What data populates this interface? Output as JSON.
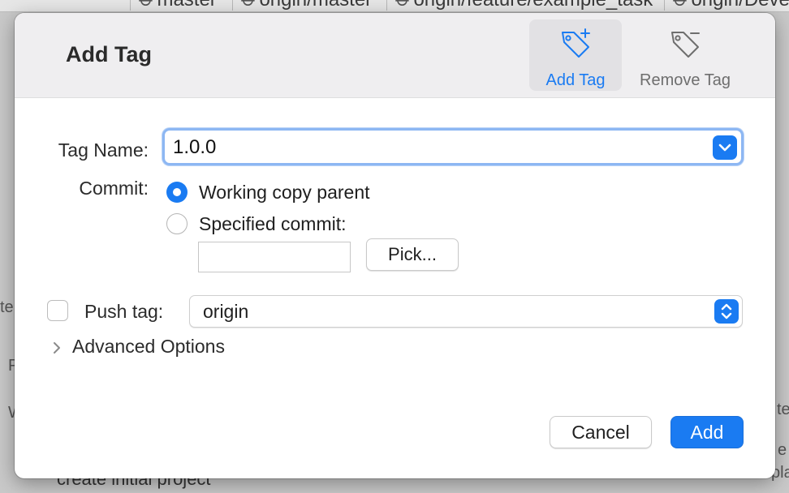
{
  "background": {
    "branches": [
      "master",
      "origin/master",
      "origin/feature/example_task",
      "origin/Deve"
    ],
    "commit_message": "create initial project",
    "edge_fragments": {
      "left1": "te",
      "left2": "P",
      "left3": "W",
      "right1": "te",
      "right2": "e",
      "right3": "pla"
    }
  },
  "dialog": {
    "title": "Add Tag",
    "toolbar": {
      "add_tag_label": "Add Tag",
      "remove_tag_label": "Remove Tag",
      "add_tag_icon": "tag-plus-icon",
      "remove_tag_icon": "tag-minus-icon"
    },
    "tag_name": {
      "label": "Tag Name:",
      "value": "1.0.0"
    },
    "commit": {
      "label": "Commit:",
      "options": [
        {
          "label": "Working copy parent",
          "selected": true
        },
        {
          "label": "Specified commit:",
          "selected": false
        }
      ],
      "specified_value": "",
      "pick_label": "Pick..."
    },
    "push": {
      "label": "Push tag:",
      "checked": false,
      "remote": "origin"
    },
    "advanced": {
      "label": "Advanced Options",
      "expanded": false
    },
    "buttons": {
      "cancel": "Cancel",
      "add": "Add"
    }
  },
  "colors": {
    "accent": "#1a7bf2",
    "header_bg": "#efeef0",
    "focus_ring": "#8db7f3"
  }
}
